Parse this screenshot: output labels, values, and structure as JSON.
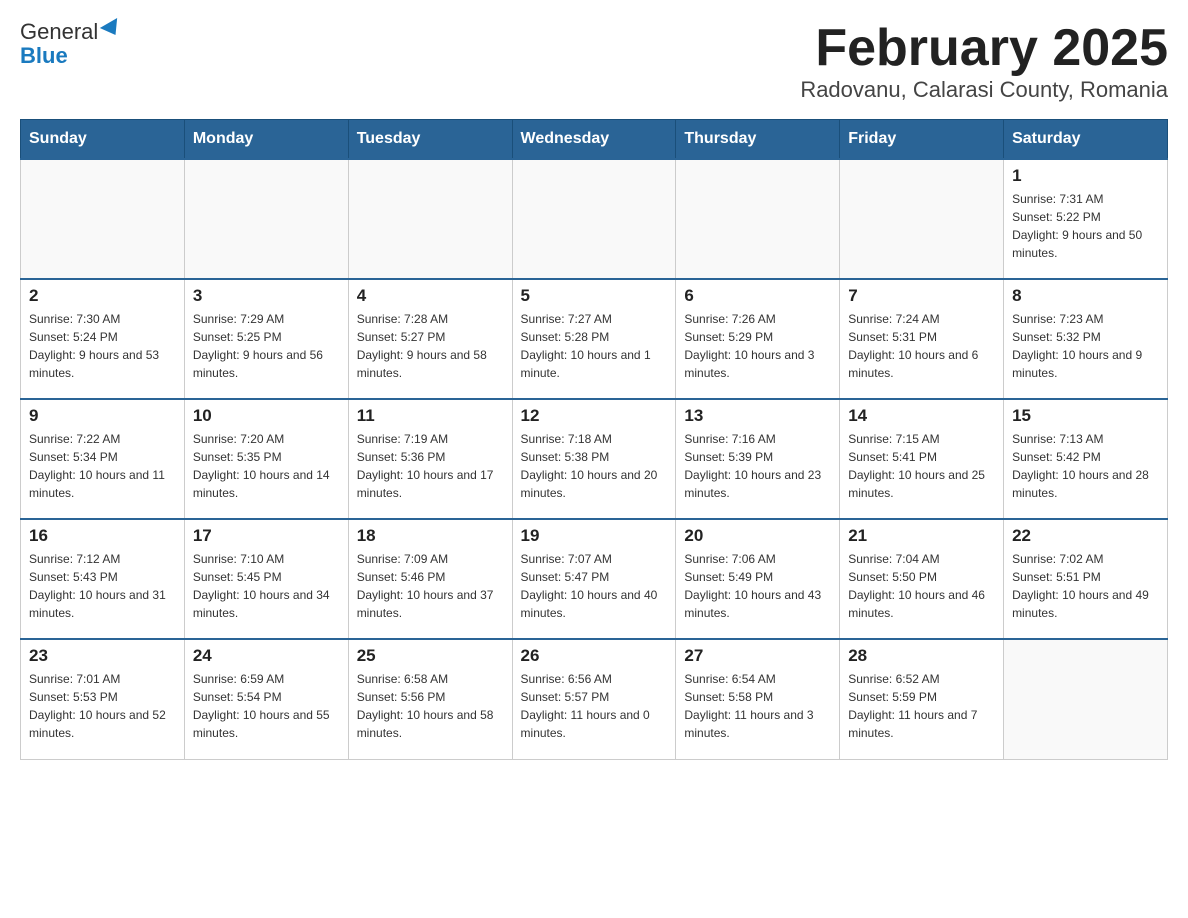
{
  "logo": {
    "text_general": "General",
    "text_blue": "Blue"
  },
  "title": "February 2025",
  "subtitle": "Radovanu, Calarasi County, Romania",
  "days_of_week": [
    "Sunday",
    "Monday",
    "Tuesday",
    "Wednesday",
    "Thursday",
    "Friday",
    "Saturday"
  ],
  "weeks": [
    [
      {
        "day": "",
        "info": ""
      },
      {
        "day": "",
        "info": ""
      },
      {
        "day": "",
        "info": ""
      },
      {
        "day": "",
        "info": ""
      },
      {
        "day": "",
        "info": ""
      },
      {
        "day": "",
        "info": ""
      },
      {
        "day": "1",
        "info": "Sunrise: 7:31 AM\nSunset: 5:22 PM\nDaylight: 9 hours and 50 minutes."
      }
    ],
    [
      {
        "day": "2",
        "info": "Sunrise: 7:30 AM\nSunset: 5:24 PM\nDaylight: 9 hours and 53 minutes."
      },
      {
        "day": "3",
        "info": "Sunrise: 7:29 AM\nSunset: 5:25 PM\nDaylight: 9 hours and 56 minutes."
      },
      {
        "day": "4",
        "info": "Sunrise: 7:28 AM\nSunset: 5:27 PM\nDaylight: 9 hours and 58 minutes."
      },
      {
        "day": "5",
        "info": "Sunrise: 7:27 AM\nSunset: 5:28 PM\nDaylight: 10 hours and 1 minute."
      },
      {
        "day": "6",
        "info": "Sunrise: 7:26 AM\nSunset: 5:29 PM\nDaylight: 10 hours and 3 minutes."
      },
      {
        "day": "7",
        "info": "Sunrise: 7:24 AM\nSunset: 5:31 PM\nDaylight: 10 hours and 6 minutes."
      },
      {
        "day": "8",
        "info": "Sunrise: 7:23 AM\nSunset: 5:32 PM\nDaylight: 10 hours and 9 minutes."
      }
    ],
    [
      {
        "day": "9",
        "info": "Sunrise: 7:22 AM\nSunset: 5:34 PM\nDaylight: 10 hours and 11 minutes."
      },
      {
        "day": "10",
        "info": "Sunrise: 7:20 AM\nSunset: 5:35 PM\nDaylight: 10 hours and 14 minutes."
      },
      {
        "day": "11",
        "info": "Sunrise: 7:19 AM\nSunset: 5:36 PM\nDaylight: 10 hours and 17 minutes."
      },
      {
        "day": "12",
        "info": "Sunrise: 7:18 AM\nSunset: 5:38 PM\nDaylight: 10 hours and 20 minutes."
      },
      {
        "day": "13",
        "info": "Sunrise: 7:16 AM\nSunset: 5:39 PM\nDaylight: 10 hours and 23 minutes."
      },
      {
        "day": "14",
        "info": "Sunrise: 7:15 AM\nSunset: 5:41 PM\nDaylight: 10 hours and 25 minutes."
      },
      {
        "day": "15",
        "info": "Sunrise: 7:13 AM\nSunset: 5:42 PM\nDaylight: 10 hours and 28 minutes."
      }
    ],
    [
      {
        "day": "16",
        "info": "Sunrise: 7:12 AM\nSunset: 5:43 PM\nDaylight: 10 hours and 31 minutes."
      },
      {
        "day": "17",
        "info": "Sunrise: 7:10 AM\nSunset: 5:45 PM\nDaylight: 10 hours and 34 minutes."
      },
      {
        "day": "18",
        "info": "Sunrise: 7:09 AM\nSunset: 5:46 PM\nDaylight: 10 hours and 37 minutes."
      },
      {
        "day": "19",
        "info": "Sunrise: 7:07 AM\nSunset: 5:47 PM\nDaylight: 10 hours and 40 minutes."
      },
      {
        "day": "20",
        "info": "Sunrise: 7:06 AM\nSunset: 5:49 PM\nDaylight: 10 hours and 43 minutes."
      },
      {
        "day": "21",
        "info": "Sunrise: 7:04 AM\nSunset: 5:50 PM\nDaylight: 10 hours and 46 minutes."
      },
      {
        "day": "22",
        "info": "Sunrise: 7:02 AM\nSunset: 5:51 PM\nDaylight: 10 hours and 49 minutes."
      }
    ],
    [
      {
        "day": "23",
        "info": "Sunrise: 7:01 AM\nSunset: 5:53 PM\nDaylight: 10 hours and 52 minutes."
      },
      {
        "day": "24",
        "info": "Sunrise: 6:59 AM\nSunset: 5:54 PM\nDaylight: 10 hours and 55 minutes."
      },
      {
        "day": "25",
        "info": "Sunrise: 6:58 AM\nSunset: 5:56 PM\nDaylight: 10 hours and 58 minutes."
      },
      {
        "day": "26",
        "info": "Sunrise: 6:56 AM\nSunset: 5:57 PM\nDaylight: 11 hours and 0 minutes."
      },
      {
        "day": "27",
        "info": "Sunrise: 6:54 AM\nSunset: 5:58 PM\nDaylight: 11 hours and 3 minutes."
      },
      {
        "day": "28",
        "info": "Sunrise: 6:52 AM\nSunset: 5:59 PM\nDaylight: 11 hours and 7 minutes."
      },
      {
        "day": "",
        "info": ""
      }
    ]
  ]
}
